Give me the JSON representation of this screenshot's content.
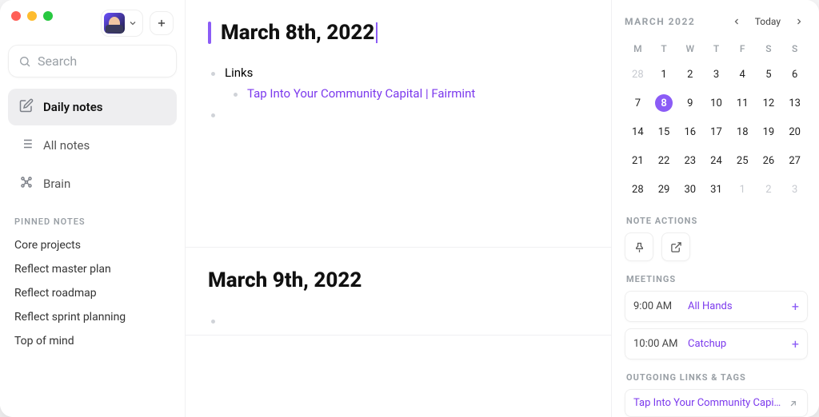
{
  "sidebar": {
    "search_placeholder": "Search",
    "nav": [
      {
        "label": "Daily notes",
        "icon": "edit-note-icon",
        "active": true
      },
      {
        "label": "All notes",
        "icon": "list-icon",
        "active": false
      },
      {
        "label": "Brain",
        "icon": "brain-icon",
        "active": false
      }
    ],
    "pinned_label": "PINNED NOTES",
    "pinned": [
      "Core projects",
      "Reflect master plan",
      "Reflect roadmap",
      "Reflect sprint planning",
      "Top of mind"
    ]
  },
  "notes": [
    {
      "title": "March 8th, 2022",
      "active": true,
      "bullets": [
        {
          "text": "Links",
          "indent": 0
        },
        {
          "text": "Tap Into Your Community Capital | Fairmint",
          "indent": 1,
          "link": true
        },
        {
          "text": "",
          "indent": 0
        }
      ]
    },
    {
      "title": "March 9th, 2022",
      "active": false,
      "bullets": [
        {
          "text": "",
          "indent": 0
        }
      ]
    }
  ],
  "calendar": {
    "label": "MARCH 2022",
    "today_label": "Today",
    "dow": [
      "M",
      "T",
      "W",
      "T",
      "F",
      "S",
      "S"
    ],
    "days": [
      {
        "n": 28,
        "muted": true
      },
      {
        "n": 1
      },
      {
        "n": 2
      },
      {
        "n": 3
      },
      {
        "n": 4
      },
      {
        "n": 5
      },
      {
        "n": 6
      },
      {
        "n": 7
      },
      {
        "n": 8,
        "selected": true
      },
      {
        "n": 9
      },
      {
        "n": 10
      },
      {
        "n": 11
      },
      {
        "n": 12
      },
      {
        "n": 13
      },
      {
        "n": 14
      },
      {
        "n": 15
      },
      {
        "n": 16
      },
      {
        "n": 17
      },
      {
        "n": 18
      },
      {
        "n": 19
      },
      {
        "n": 20
      },
      {
        "n": 21
      },
      {
        "n": 22
      },
      {
        "n": 23
      },
      {
        "n": 24
      },
      {
        "n": 25
      },
      {
        "n": 26
      },
      {
        "n": 27
      },
      {
        "n": 28
      },
      {
        "n": 29
      },
      {
        "n": 30
      },
      {
        "n": 31
      },
      {
        "n": 1,
        "muted": true
      },
      {
        "n": 2,
        "muted": true
      },
      {
        "n": 3,
        "muted": true
      }
    ]
  },
  "sections": {
    "note_actions": "NOTE ACTIONS",
    "meetings": "MEETINGS",
    "outgoing": "OUTGOING LINKS & TAGS"
  },
  "meetings": [
    {
      "time": "9:00 AM",
      "title": "All Hands"
    },
    {
      "time": "10:00 AM",
      "title": "Catchup"
    }
  ],
  "outgoing_links": [
    "Tap Into Your Community Capital..."
  ]
}
